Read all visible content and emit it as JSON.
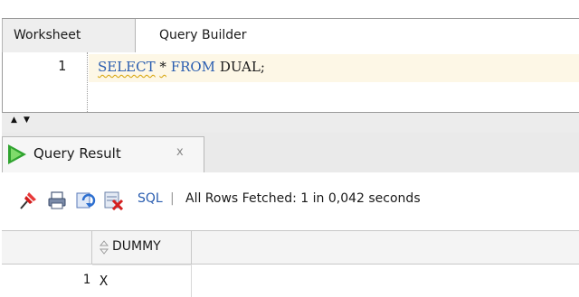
{
  "editor": {
    "tabs": [
      {
        "label": "Worksheet",
        "active": true
      },
      {
        "label": "Query Builder",
        "active": false
      }
    ],
    "line_number": "1",
    "code": {
      "kw_select": "SELECT",
      "star": "*",
      "kw_from": "FROM",
      "table": "DUAL;"
    }
  },
  "splitter": {
    "up_glyph": "▲",
    "down_glyph": "▼"
  },
  "results": {
    "tab_label": "Query Result",
    "tab_close": "x",
    "toolbar": {
      "icons": [
        "pin-icon",
        "print-icon",
        "refresh-icon",
        "delete-icon"
      ],
      "sql_label": "SQL",
      "separator": "|",
      "status": "All Rows Fetched: 1 in 0,042 seconds"
    },
    "grid": {
      "columns": [
        "DUMMY"
      ],
      "rows": [
        {
          "num": "1",
          "values": [
            "X"
          ]
        }
      ]
    }
  },
  "colors": {
    "keyword": "#2a5db0",
    "current_line": "#fdf7e6",
    "run_icon": "#2fa32f"
  }
}
